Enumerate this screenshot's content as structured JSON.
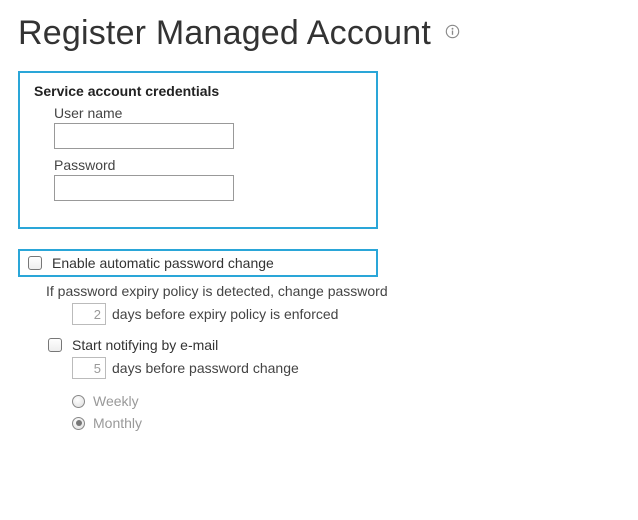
{
  "page": {
    "title": "Register Managed Account"
  },
  "credentials": {
    "sectionTitle": "Service account credentials",
    "username": {
      "label": "User name",
      "value": ""
    },
    "password": {
      "label": "Password",
      "value": ""
    }
  },
  "autoPwd": {
    "enableLabel": "Enable automatic password change",
    "expiryLine1": "If password expiry policy is detected, change password",
    "daysBeforeExpiry": "2",
    "expiryLine2": "days before expiry policy is enforced",
    "notifyLabel": "Start notifying by e-mail",
    "daysBeforeChange": "5",
    "notifyLine2": "days before password change",
    "schedule": {
      "weekly": "Weekly",
      "monthly": "Monthly",
      "selected": "monthly"
    }
  }
}
